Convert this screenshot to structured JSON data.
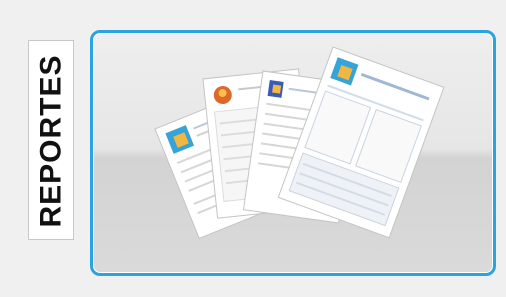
{
  "side_label": {
    "text": "REPORTES"
  },
  "report_tile": {
    "icon": "report-documents-icon",
    "accent_color": "#2aa4de"
  }
}
